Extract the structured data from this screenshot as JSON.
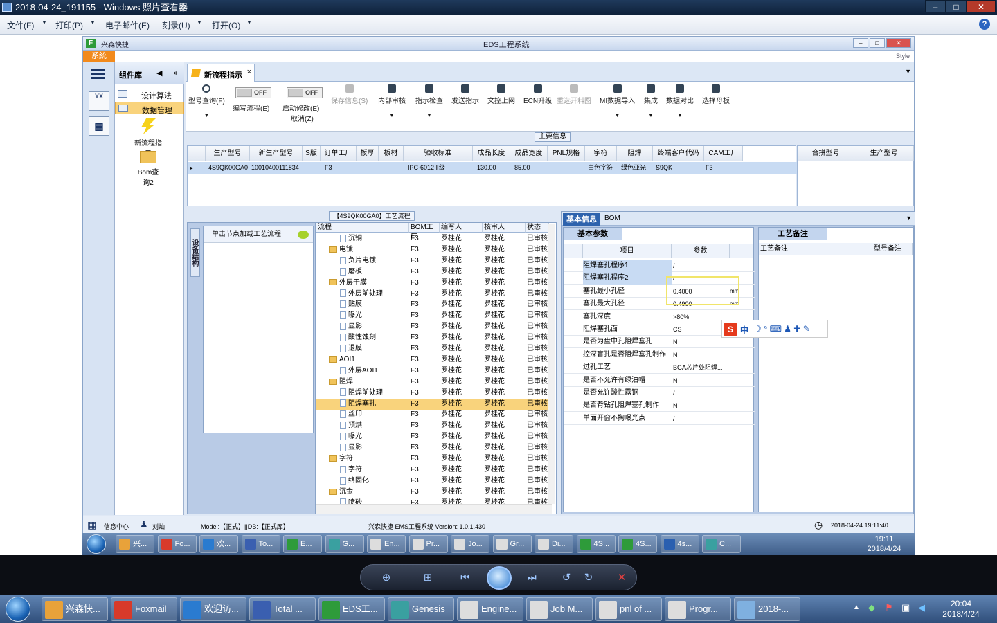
{
  "viewer": {
    "title": "2018-04-24_191155 - Windows 照片查看器",
    "menu": [
      "文件(F)",
      "打印(P)",
      "电子邮件(E)",
      "刻录(U)",
      "打开(O)"
    ]
  },
  "app": {
    "title": "EDS工程系统",
    "launcher": "兴森快捷",
    "style_label": "Style",
    "sys_tab": "系統",
    "nav_badge": "YX",
    "component_panel": {
      "title": "组件库",
      "items": [
        "设计算法",
        "数据管理"
      ],
      "big_items": [
        "新流程指示",
        "Bom查询2"
      ]
    },
    "doc_tab": "新流程指示",
    "toolbar": {
      "query": "型号查询(F)",
      "edit_flow": "编写流程(E)",
      "toggle_off": "OFF",
      "enable_modify": "启动修改(E)",
      "cancel": "取消(Z)",
      "save": "保存信息(S)",
      "internal_review": "内部审核",
      "check": "指示检查",
      "send": "发送指示",
      "upload": "文控上网",
      "ecn": "ECN升级",
      "reselect": "重选开料图",
      "mi_import": "MI数据导入",
      "integrate": "集成",
      "compare": "数据对比",
      "template": "选择母板"
    },
    "main_info_label": "主要信息",
    "main_grid": {
      "headers": [
        "生产型号",
        "新生产型号",
        "S版",
        "订单工厂",
        "板厚",
        "板材",
        "验收标准",
        "成品长度",
        "成品宽度",
        "PNL规格",
        "字符",
        "阻焊",
        "终端客户代码",
        "CAM工厂"
      ],
      "row": [
        "4S9QK00GA0",
        "10010400111834",
        "F3",
        "",
        "",
        "",
        "IPC-6012 Ⅱ级",
        "130.00",
        "85.00",
        "",
        "白色字符",
        "绿色亚光",
        "S9QK",
        "F3"
      ]
    },
    "side_grid": {
      "headers": [
        "合拼型号",
        "生产型号"
      ]
    },
    "process": {
      "title": "【4S9QK00GA0】工艺流程",
      "vertical_tab": "设备结构",
      "hint": "单击节点加载工艺流程",
      "columns": [
        "流程",
        "BOM工厂",
        "编写人",
        "核审人",
        "状态"
      ],
      "rows": [
        {
          "level": 2,
          "type": "doc",
          "name": "沉铜",
          "factory": "F3",
          "writer": "罗桂花",
          "reviewer": "罗桂花",
          "status": "已审核"
        },
        {
          "level": 1,
          "type": "folder",
          "name": "电镀",
          "factory": "F3",
          "writer": "罗桂花",
          "reviewer": "罗桂花",
          "status": "已审核"
        },
        {
          "level": 2,
          "type": "doc",
          "name": "负片电镀",
          "factory": "F3",
          "writer": "罗桂花",
          "reviewer": "罗桂花",
          "status": "已审核"
        },
        {
          "level": 2,
          "type": "doc",
          "name": "磨板",
          "factory": "F3",
          "writer": "罗桂花",
          "reviewer": "罗桂花",
          "status": "已审核"
        },
        {
          "level": 1,
          "type": "folder",
          "name": "外层干膜",
          "factory": "F3",
          "writer": "罗桂花",
          "reviewer": "罗桂花",
          "status": "已审核"
        },
        {
          "level": 2,
          "type": "doc",
          "name": "外层前处理",
          "factory": "F3",
          "writer": "罗桂花",
          "reviewer": "罗桂花",
          "status": "已审核"
        },
        {
          "level": 2,
          "type": "doc",
          "name": "贴膜",
          "factory": "F3",
          "writer": "罗桂花",
          "reviewer": "罗桂花",
          "status": "已审核"
        },
        {
          "level": 2,
          "type": "doc",
          "name": "曝光",
          "factory": "F3",
          "writer": "罗桂花",
          "reviewer": "罗桂花",
          "status": "已审核"
        },
        {
          "level": 2,
          "type": "doc",
          "name": "显影",
          "factory": "F3",
          "writer": "罗桂花",
          "reviewer": "罗桂花",
          "status": "已审核"
        },
        {
          "level": 2,
          "type": "doc",
          "name": "酸性蚀刻",
          "factory": "F3",
          "writer": "罗桂花",
          "reviewer": "罗桂花",
          "status": "已审核"
        },
        {
          "level": 2,
          "type": "doc",
          "name": "退膜",
          "factory": "F3",
          "writer": "罗桂花",
          "reviewer": "罗桂花",
          "status": "已审核"
        },
        {
          "level": 1,
          "type": "folder",
          "name": "AOI1",
          "factory": "F3",
          "writer": "罗桂花",
          "reviewer": "罗桂花",
          "status": "已审核"
        },
        {
          "level": 2,
          "type": "doc",
          "name": "外层AOI1",
          "factory": "F3",
          "writer": "罗桂花",
          "reviewer": "罗桂花",
          "status": "已审核"
        },
        {
          "level": 1,
          "type": "folder",
          "name": "阻焊",
          "factory": "F3",
          "writer": "罗桂花",
          "reviewer": "罗桂花",
          "status": "已审核"
        },
        {
          "level": 2,
          "type": "doc",
          "name": "阻焊前处理",
          "factory": "F3",
          "writer": "罗桂花",
          "reviewer": "罗桂花",
          "status": "已审核"
        },
        {
          "level": 2,
          "type": "doc",
          "name": "阻焊塞孔",
          "factory": "F3",
          "writer": "罗桂花",
          "reviewer": "罗桂花",
          "status": "已审核",
          "selected": true
        },
        {
          "level": 2,
          "type": "doc",
          "name": "丝印",
          "factory": "F3",
          "writer": "罗桂花",
          "reviewer": "罗桂花",
          "status": "已审核"
        },
        {
          "level": 2,
          "type": "doc",
          "name": "预烘",
          "factory": "F3",
          "writer": "罗桂花",
          "reviewer": "罗桂花",
          "status": "已审核"
        },
        {
          "level": 2,
          "type": "doc",
          "name": "曝光",
          "factory": "F3",
          "writer": "罗桂花",
          "reviewer": "罗桂花",
          "status": "已审核"
        },
        {
          "level": 2,
          "type": "doc",
          "name": "显影",
          "factory": "F3",
          "writer": "罗桂花",
          "reviewer": "罗桂花",
          "status": "已审核"
        },
        {
          "level": 1,
          "type": "folder",
          "name": "字符",
          "factory": "F3",
          "writer": "罗桂花",
          "reviewer": "罗桂花",
          "status": "已审核"
        },
        {
          "level": 2,
          "type": "doc",
          "name": "字符",
          "factory": "F3",
          "writer": "罗桂花",
          "reviewer": "罗桂花",
          "status": "已审核"
        },
        {
          "level": 2,
          "type": "doc",
          "name": "终固化",
          "factory": "F3",
          "writer": "罗桂花",
          "reviewer": "罗桂花",
          "status": "已审核"
        },
        {
          "level": 1,
          "type": "folder",
          "name": "沉金",
          "factory": "F3",
          "writer": "罗桂花",
          "reviewer": "罗桂花",
          "status": "已审核"
        },
        {
          "level": 2,
          "type": "doc",
          "name": "喷砂",
          "factory": "F3",
          "writer": "罗桂花",
          "reviewer": "罗桂花",
          "status": "已审核"
        }
      ]
    },
    "info": {
      "tabs": [
        "基本信息",
        "BOM"
      ],
      "sub_tab": "基本参数",
      "headers": [
        "项目",
        "参数"
      ],
      "rows": [
        {
          "name": "阻焊塞孔程序1",
          "value": "/",
          "unit": "",
          "highlight": true
        },
        {
          "name": "阻焊塞孔程序2",
          "value": "/",
          "unit": "",
          "highlight": true
        },
        {
          "name": "塞孔最小孔径",
          "value": "0.4000",
          "unit": "mm"
        },
        {
          "name": "塞孔最大孔径",
          "value": "0.4900",
          "unit": "mm"
        },
        {
          "name": "塞孔深度",
          "value": ">80%",
          "unit": ""
        },
        {
          "name": "阻焊塞孔面",
          "value": "CS",
          "unit": ""
        },
        {
          "name": "是否为盘中孔阻焊塞孔",
          "value": "N",
          "unit": ""
        },
        {
          "name": "控深盲孔是否阻焊塞孔制作",
          "value": "N",
          "unit": ""
        },
        {
          "name": "过孔工艺",
          "value": "BGA芯片处阻焊...",
          "unit": ""
        },
        {
          "name": "是否不允许有绿油帽",
          "value": "N",
          "unit": ""
        },
        {
          "name": "是否允许酸性露铜",
          "value": "/",
          "unit": ""
        },
        {
          "name": "是否背钻孔阻焊塞孔制作",
          "value": "N",
          "unit": ""
        },
        {
          "name": "单面开窗不掏曝光点",
          "value": "/",
          "unit": ""
        }
      ]
    },
    "remarks": {
      "sub_tab": "工艺备注",
      "headers": [
        "工艺备注",
        "型号备注"
      ]
    },
    "ime": {
      "label": "中"
    },
    "status": {
      "info_center": "信息中心",
      "user": "刘灿",
      "model": "Model:【正式】||DB:【正式库】",
      "version": "兴森快捷 EMS工程系统 Version: 1.0.1.430",
      "datetime": "2018-04-24 19:11:40"
    }
  },
  "inner_taskbar": {
    "tasks": [
      "兴...",
      "Fo...",
      "欢...",
      "To...",
      "E...",
      "G...",
      "En...",
      "Pr...",
      "Jo...",
      "Gr...",
      "Di...",
      "4S...",
      "4S...",
      "4s...",
      "C..."
    ],
    "time": "19:11",
    "date": "2018/4/24"
  },
  "taskbar": {
    "tasks": [
      "兴森快...",
      "Foxmail",
      "欢迎访...",
      "Total ...",
      "EDS工...",
      "Genesis",
      "Engine...",
      "Job M...",
      "pnl of ...",
      "Progr...",
      "2018-..."
    ],
    "time": "20:04",
    "date": "2018/4/24"
  },
  "colors": {
    "accent": "#2e63ad",
    "highlight_row": "#f9d37c",
    "selection_box": "#f1e56a",
    "sys_tab": "#f28a1c"
  }
}
